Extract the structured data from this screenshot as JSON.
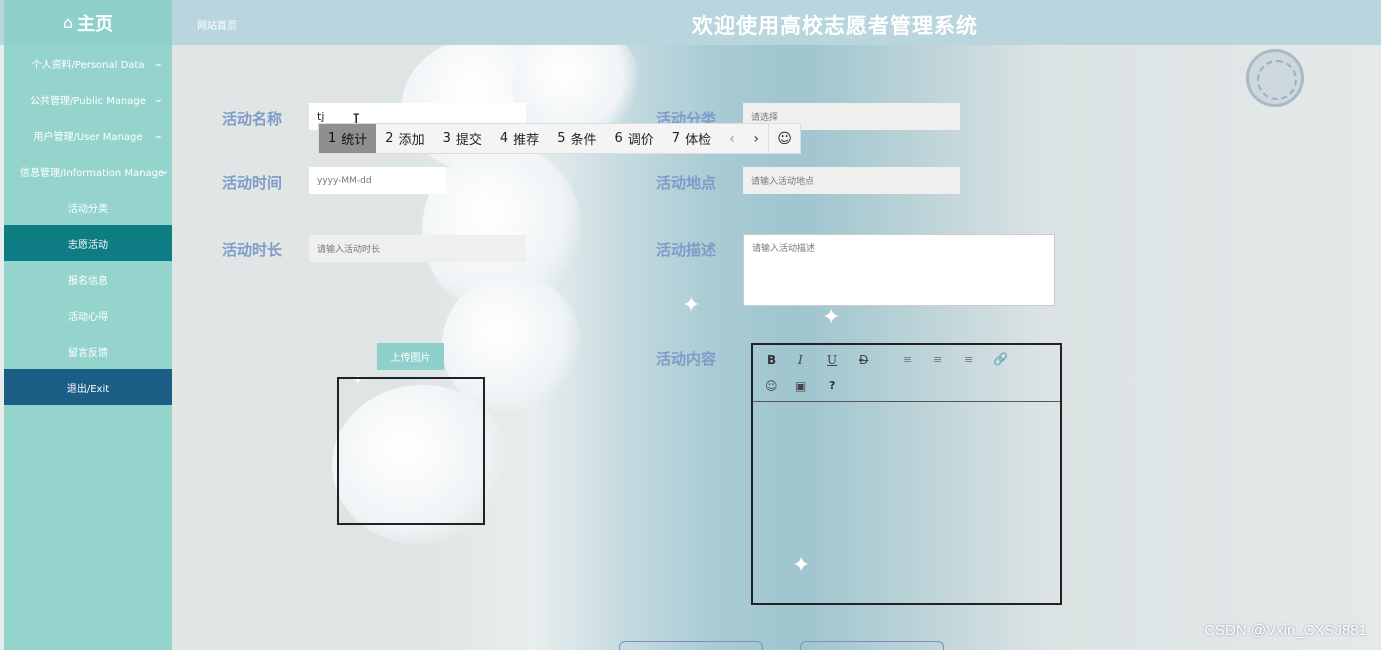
{
  "header": {
    "brand_icon": "home-icon",
    "brand_label": "主页",
    "site_link": "网站首页",
    "title": "欢迎使用高校志愿者管理系统"
  },
  "sidebar": {
    "groups": [
      {
        "label": "个人资料/Personal Data",
        "icon": "chevron-down-icon"
      },
      {
        "label": "公共管理/Public Manage",
        "icon": "chevron-down-icon"
      },
      {
        "label": "用户管理/User Manage",
        "icon": "chevron-down-icon"
      },
      {
        "label": "信息管理/Information Manage",
        "icon": "chevron-down-icon"
      }
    ],
    "items": [
      {
        "label": "活动分类"
      },
      {
        "label": "志愿活动",
        "active": true
      },
      {
        "label": "报名信息"
      },
      {
        "label": "活动心得"
      },
      {
        "label": "留言反馈"
      }
    ],
    "exit_label": "退出/Exit"
  },
  "form": {
    "name_label": "活动名称",
    "name_value": "tj",
    "category_label": "活动分类",
    "category_placeholder": "请选择",
    "time_label": "活动时间",
    "time_placeholder": "yyyy-MM-dd",
    "location_label": "活动地点",
    "location_placeholder": "请输入活动地点",
    "duration_label": "活动时长",
    "duration_placeholder": "请输入活动时长",
    "description_label": "活动描述",
    "description_placeholder": "请输入活动描述",
    "upload_label": "上传图片",
    "content_label": "活动内容"
  },
  "editor": {
    "toolbar": [
      "B",
      "I",
      "U",
      "Đ",
      "?"
    ],
    "toolbar_icons": [
      "bold-icon",
      "italic-icon",
      "underline-icon",
      "strikethrough-icon",
      "align-left-icon",
      "align-center-icon",
      "align-right-icon",
      "link-icon",
      "emoji-icon",
      "image-icon",
      "help-icon"
    ]
  },
  "ime": {
    "candidates": [
      {
        "num": "1",
        "text": "统计"
      },
      {
        "num": "2",
        "text": "添加"
      },
      {
        "num": "3",
        "text": "提交"
      },
      {
        "num": "4",
        "text": "推荐"
      },
      {
        "num": "5",
        "text": "条件"
      },
      {
        "num": "6",
        "text": "调价"
      },
      {
        "num": "7",
        "text": "体检"
      }
    ],
    "prev": "‹",
    "next": "›",
    "emoji": "☺"
  },
  "watermark": "CSDN @Vxin_CXSJ881"
}
